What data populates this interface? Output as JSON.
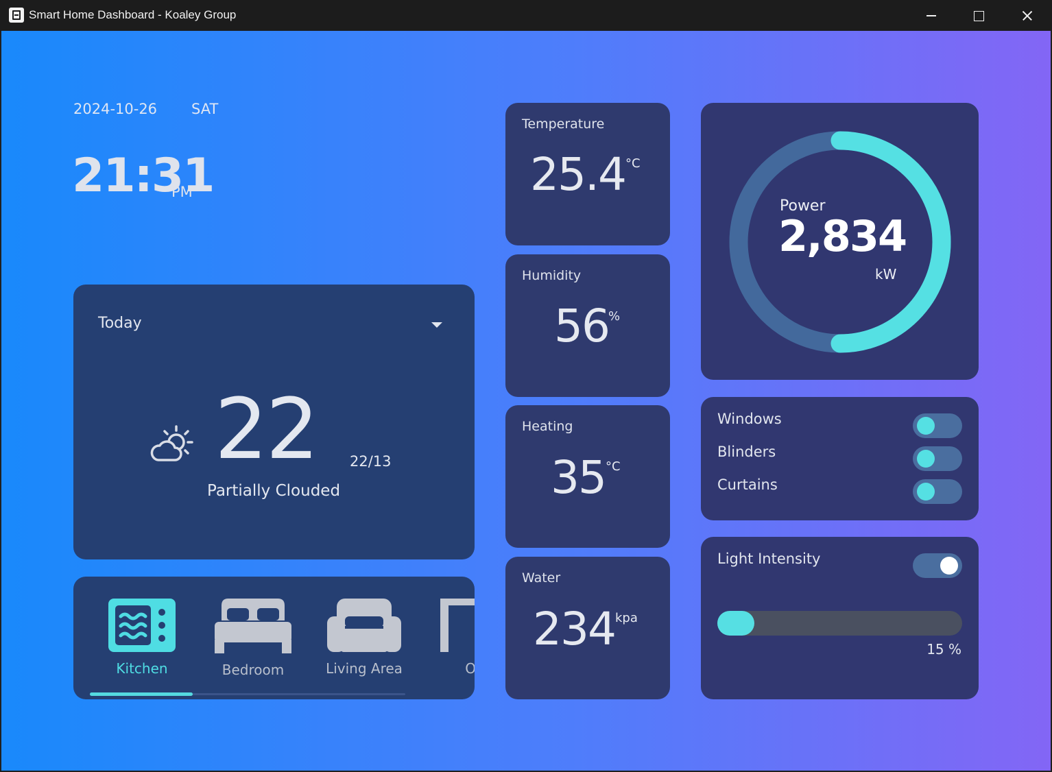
{
  "window": {
    "title": "Smart Home Dashboard - Koaley Group"
  },
  "header": {
    "date": "2024-10-26",
    "day": "SAT",
    "time": "21:31",
    "ampm": "PM"
  },
  "weather": {
    "period": "Today",
    "temperature": "22",
    "high_low": "22/13",
    "condition": "Partially Clouded",
    "icon": "partly-cloudy-icon"
  },
  "rooms": {
    "items": [
      {
        "label": "Kitchen",
        "icon": "kitchen-icon",
        "active": true
      },
      {
        "label": "Bedroom",
        "icon": "bed-icon",
        "active": false
      },
      {
        "label": "Living Area",
        "icon": "sofa-icon",
        "active": false
      },
      {
        "label": "Off",
        "icon": "office-icon",
        "active": false
      }
    ]
  },
  "stats": [
    {
      "label": "Temperature",
      "value": "25.4",
      "unit": "°C"
    },
    {
      "label": "Humidity",
      "value": "56",
      "unit": "%"
    },
    {
      "label": "Heating",
      "value": "35",
      "unit": "°C"
    },
    {
      "label": "Water",
      "value": "234",
      "unit": "kpa"
    }
  ],
  "power": {
    "label": "Power",
    "value": "2,834",
    "unit": "kW",
    "gauge_fraction": 0.5
  },
  "switches": [
    {
      "label": "Windows",
      "on": false
    },
    {
      "label": "Blinders",
      "on": false
    },
    {
      "label": "Curtains",
      "on": false
    }
  ],
  "light": {
    "label": "Light Intensity",
    "enabled": true,
    "percent_text": "15 %",
    "level": 0.15
  },
  "colors": {
    "accent": "#55dfe3",
    "card_blue": "#253f72",
    "card_navy": "#313770"
  }
}
